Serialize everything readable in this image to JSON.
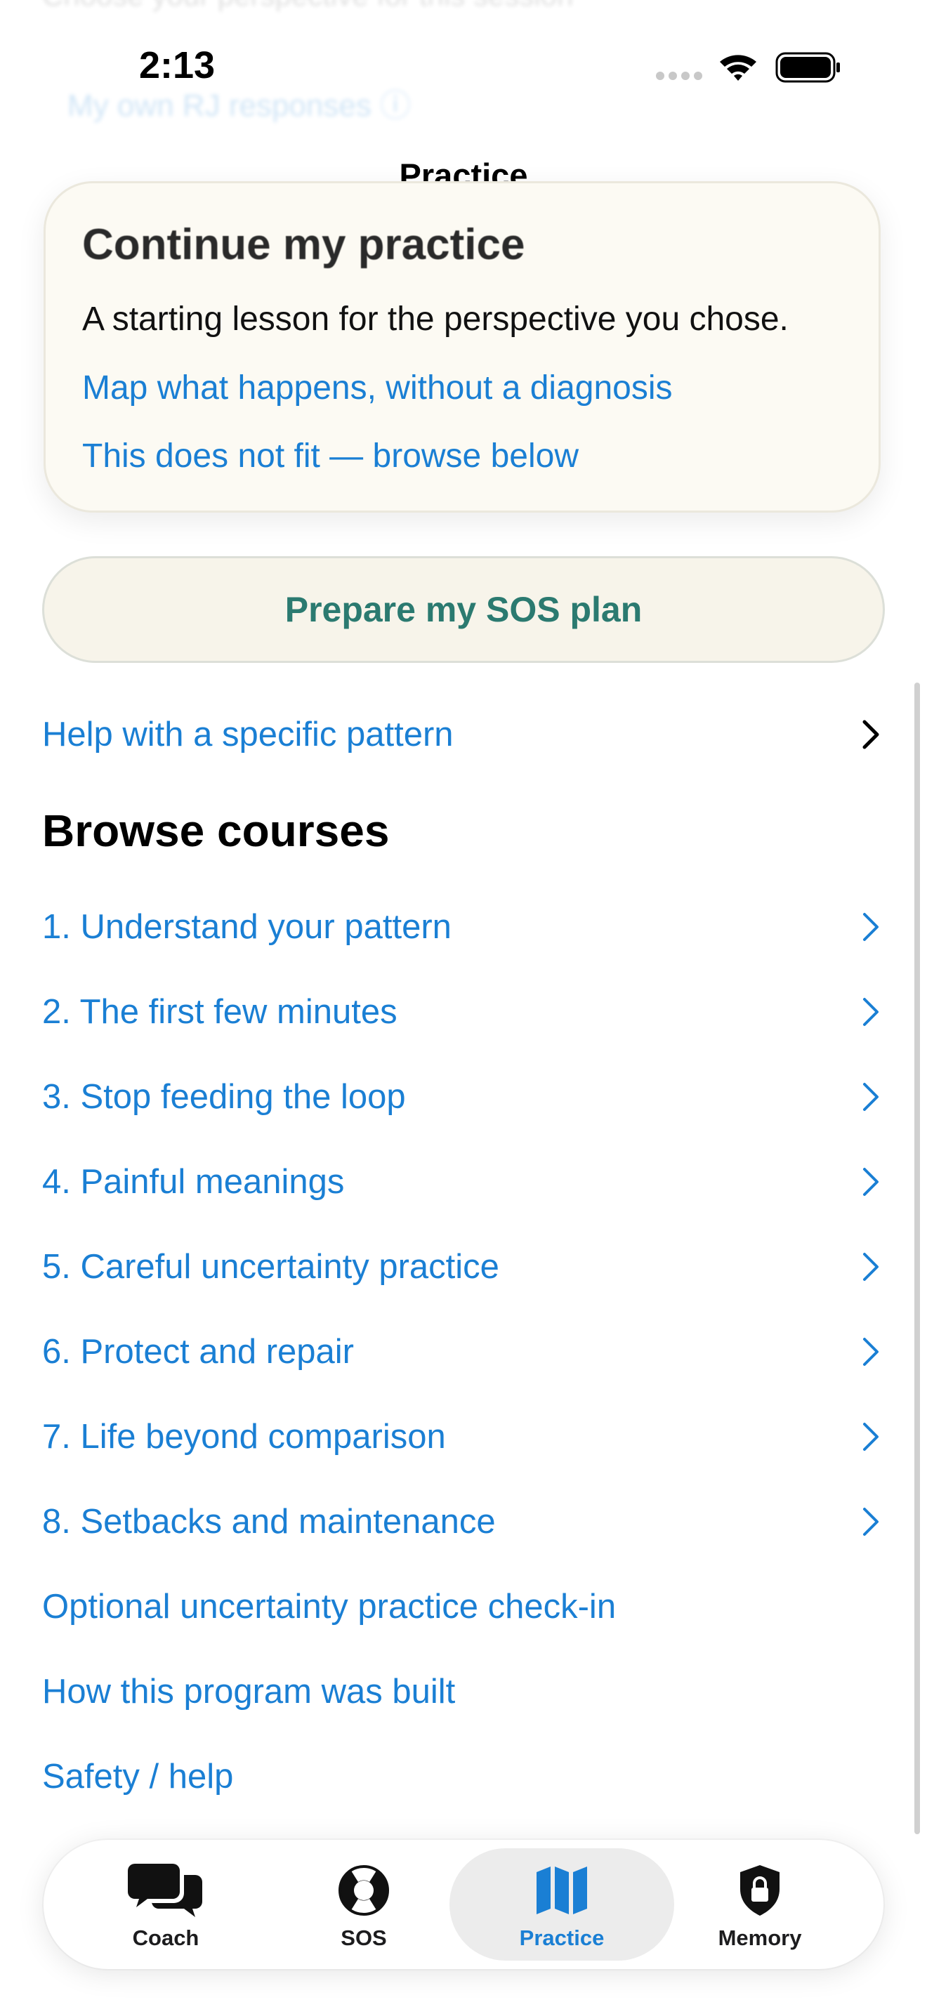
{
  "background": {
    "ghost_heading": "Choose your perspective for this session",
    "ghost_link": "My own RJ responses ⓘ"
  },
  "status_bar": {
    "time": "2:13"
  },
  "nav": {
    "title": "Practice"
  },
  "continue_card": {
    "title": "Continue my practice",
    "description": "A starting lesson for the perspective you chose.",
    "primary_link": "Map what happens, without a diagnosis",
    "secondary_link": "This does not fit — browse below"
  },
  "sos_button": {
    "label": "Prepare my SOS plan"
  },
  "specific_pattern": {
    "label": "Help with a specific pattern"
  },
  "browse": {
    "heading": "Browse courses",
    "courses": [
      "1. Understand your pattern",
      "2. The first few minutes",
      "3. Stop feeding the loop",
      "4. Painful meanings",
      "5. Careful uncertainty practice",
      "6. Protect and repair",
      "7. Life beyond comparison",
      "8. Setbacks and maintenance"
    ],
    "extra_links": [
      "Optional uncertainty practice check-in",
      "How this program was built",
      "Safety / help"
    ]
  },
  "tab_bar": {
    "active": "Practice",
    "tabs": [
      {
        "label": "Coach",
        "icon": "chat-bubbles-icon"
      },
      {
        "label": "SOS",
        "icon": "lifebuoy-icon"
      },
      {
        "label": "Practice",
        "icon": "map-icon"
      },
      {
        "label": "Memory",
        "icon": "lock-shield-icon"
      }
    ]
  },
  "colors": {
    "link": "#1a7fd4",
    "sos_text": "#2b7a70",
    "card_bg": "#fcfaf3",
    "chevron_courses": "#1a7fd4",
    "chevron_pattern": "#000000"
  }
}
